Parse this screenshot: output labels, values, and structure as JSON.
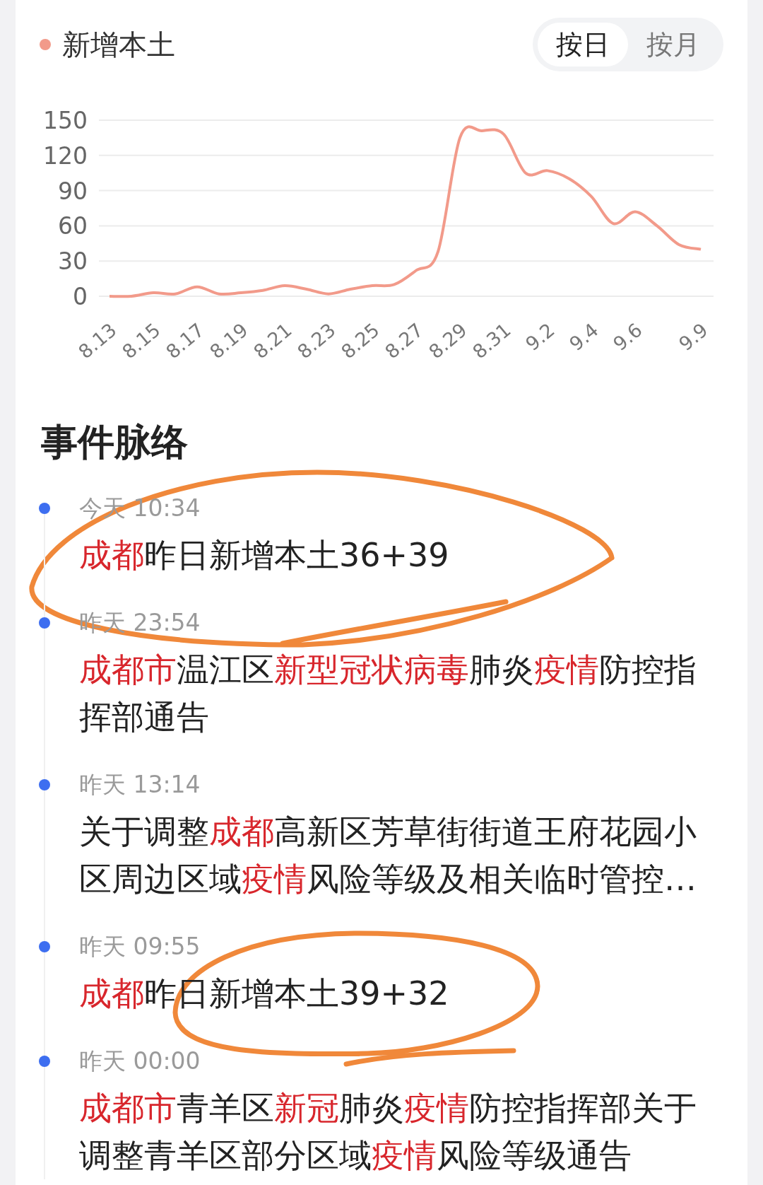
{
  "toggle": [
    {
      "label": "按日",
      "selected": true
    },
    {
      "label": "按月",
      "selected": false
    }
  ],
  "chart_data": {
    "type": "line",
    "grid": true,
    "categories": [
      "8.13",
      null,
      "8.15",
      null,
      "8.17",
      null,
      "8.19",
      null,
      "8.21",
      null,
      "8.23",
      null,
      "8.25",
      null,
      "8.27",
      null,
      "8.29",
      null,
      "8.31",
      null,
      "9.2",
      null,
      "9.4",
      null,
      "9.6",
      null,
      null,
      "9.9"
    ],
    "series": [
      {
        "name": "新增本土",
        "color": "#f29a8a",
        "values": [
          0,
          0,
          3,
          2,
          8,
          2,
          3,
          5,
          9,
          6,
          2,
          6,
          9,
          10,
          22,
          38,
          135,
          141,
          138,
          105,
          107,
          100,
          85,
          62,
          72,
          60,
          44,
          40
        ]
      }
    ],
    "ylim": [
      0,
      150
    ],
    "yticks": [
      0,
      30,
      60,
      90,
      120,
      150
    ]
  },
  "timeline": {
    "title": "事件脉络",
    "items": [
      {
        "time": "今天 10:34",
        "text": [
          {
            "text": "成都",
            "highlight": true
          },
          {
            "text": "昨日新增本土36+39",
            "highlight": false
          }
        ]
      },
      {
        "time": "昨天 23:54",
        "text": [
          {
            "text": "成都市",
            "highlight": true
          },
          {
            "text": "温江区",
            "highlight": false
          },
          {
            "text": "新型冠状病毒",
            "highlight": true
          },
          {
            "text": "肺炎",
            "highlight": false
          },
          {
            "text": "疫情",
            "highlight": true
          },
          {
            "text": "防控指挥部通告",
            "highlight": false
          }
        ]
      },
      {
        "time": "昨天 13:14",
        "text": [
          {
            "text": "关于调整",
            "highlight": false
          },
          {
            "text": "成都",
            "highlight": true
          },
          {
            "text": "高新区芳草街街道王府花园小区周边区域",
            "highlight": false
          },
          {
            "text": "疫情",
            "highlight": true
          },
          {
            "text": "风险等级及相关临时管控…",
            "highlight": false
          }
        ]
      },
      {
        "time": "昨天 09:55",
        "text": [
          {
            "text": "成都",
            "highlight": true
          },
          {
            "text": "昨日新增本土39+32",
            "highlight": false
          }
        ]
      },
      {
        "time": "昨天 00:00",
        "text": [
          {
            "text": "成都市",
            "highlight": true
          },
          {
            "text": "青羊区",
            "highlight": false
          },
          {
            "text": "新冠",
            "highlight": true
          },
          {
            "text": "肺炎",
            "highlight": false
          },
          {
            "text": "疫情",
            "highlight": true
          },
          {
            "text": "防控指挥部关于调整青羊区部分区域",
            "highlight": false
          },
          {
            "text": "疫情",
            "highlight": true
          },
          {
            "text": "风险等级通告",
            "highlight": false
          }
        ]
      }
    ]
  }
}
